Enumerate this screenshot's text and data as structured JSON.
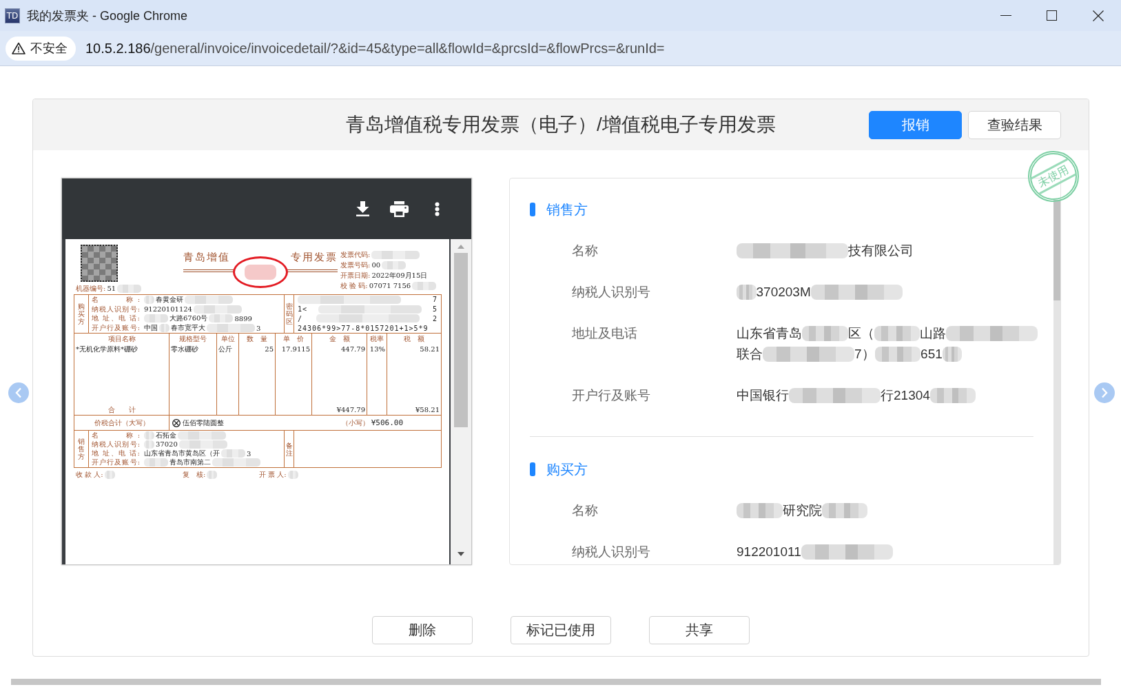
{
  "window": {
    "icon_label": "TD",
    "title": "我的发票夹 - Google Chrome"
  },
  "address_bar": {
    "security_label": "不安全",
    "url_host": "10.5.2.186",
    "url_path": "/general/invoice/invoicedetail/?&id=45&type=all&flowId=&prcsId=&flowPrcs=&runId="
  },
  "dialog": {
    "title": "青岛增值税专用发票（电子）/增值税电子专用发票",
    "actions": [
      {
        "label": "报销",
        "kind": "primary"
      },
      {
        "label": "查验结果",
        "kind": "default"
      }
    ],
    "stamp": "未使用"
  },
  "invoice": {
    "machine_number": {
      "label": "机器编号:",
      "value": [
        {
          "kind": "text",
          "text": "51"
        },
        {
          "kind": "mask_medium"
        }
      ]
    },
    "title": [
      "青岛增值",
      "专用发票"
    ],
    "header_fields": [
      {
        "label": "发票代码:",
        "value": [
          {
            "kind": "mask_long"
          }
        ]
      },
      {
        "label": "发票号码:",
        "value": [
          {
            "kind": "text",
            "text": "00"
          },
          {
            "kind": "mask_medium"
          }
        ]
      },
      {
        "label": "开票日期:",
        "value": [
          {
            "kind": "text",
            "text": "2022年09月15日"
          }
        ]
      },
      {
        "label": "校 验 码:",
        "value": [
          {
            "kind": "text",
            "text": "07071 7156"
          },
          {
            "kind": "mask_medium"
          }
        ]
      }
    ],
    "buyer": {
      "side_label": "购买方",
      "rows": [
        {
          "label": "名　　称:",
          "value": [
            {
              "kind": "mask_short"
            },
            {
              "kind": "text",
              "text": "春黄金研"
            },
            {
              "kind": "mask_long"
            }
          ]
        },
        {
          "label": "纳税人识别号:",
          "value": [
            {
              "kind": "text",
              "text": "91220101124"
            },
            {
              "kind": "mask_long"
            }
          ]
        },
        {
          "label": "地 址、电 话:",
          "value": [
            {
              "kind": "mask_medium"
            },
            {
              "kind": "text",
              "text": "大路6760号"
            },
            {
              "kind": "mask_medium"
            },
            {
              "kind": "text",
              "text": "8899"
            }
          ]
        },
        {
          "label": "开户行及账号:",
          "value": [
            {
              "kind": "text",
              "text": "中国"
            },
            {
              "kind": "mask_short"
            },
            {
              "kind": "text",
              "text": "春市宽平大"
            },
            {
              "kind": "mask_long"
            },
            {
              "kind": "text",
              "text": "3"
            }
          ]
        }
      ]
    },
    "cipher": {
      "side_label": "密码区",
      "lines": [
        [
          {
            "kind": "mask_full"
          },
          {
            "kind": "text",
            "text": "7"
          }
        ],
        [
          {
            "kind": "text",
            "text": "1<"
          },
          {
            "kind": "mask_full"
          },
          {
            "kind": "text",
            "text": "5"
          }
        ],
        [
          {
            "kind": "text",
            "text": "/"
          },
          {
            "kind": "mask_full"
          },
          {
            "kind": "text",
            "text": "2"
          }
        ],
        [
          {
            "kind": "text",
            "text": "24306*99>77-8*0157201+1>5*9"
          }
        ]
      ]
    },
    "items": {
      "columns": [
        "项目名称",
        "规格型号",
        "单位",
        "数　量",
        "单　价",
        "金　额",
        "税率",
        "税　额"
      ],
      "rows": [
        [
          "*无机化学原料*硼砂",
          "零水硼砂",
          "公斤",
          "25",
          "17.9115",
          "447.79",
          "13%",
          "58.21"
        ]
      ],
      "total_label": "合　　计",
      "total_amount": "¥447.79",
      "total_tax": "¥58.21"
    },
    "grand_total": {
      "label": "价税合计（大写）",
      "words": "伍佰零陆圆整",
      "figure_label": "（小写）",
      "figure": "¥506.00"
    },
    "seller": {
      "side_label": "销售方",
      "rows": [
        {
          "label": "名　　称:",
          "value": [
            {
              "kind": "mask_short"
            },
            {
              "kind": "text",
              "text": "石拓金"
            },
            {
              "kind": "mask_long"
            }
          ]
        },
        {
          "label": "纳税人识别号:",
          "value": [
            {
              "kind": "mask_short"
            },
            {
              "kind": "text",
              "text": "37020"
            },
            {
              "kind": "mask_long"
            }
          ]
        },
        {
          "label": "地 址、电 话:",
          "value": [
            {
              "kind": "text",
              "text": "山东省青岛市黄岛区（开"
            },
            {
              "kind": "mask_medium"
            },
            {
              "kind": "text",
              "text": "3"
            }
          ]
        },
        {
          "label": "开户行及账号:",
          "value": [
            {
              "kind": "mask_medium"
            },
            {
              "kind": "text",
              "text": "青岛市南第二"
            },
            {
              "kind": "mask_long"
            }
          ]
        }
      ],
      "remarks_label": "备注"
    },
    "signatures": [
      {
        "label": "收 款 人:",
        "value": [
          {
            "kind": "mask_short"
          }
        ]
      },
      {
        "label": "复　核:",
        "value": [
          {
            "kind": "mask_short"
          }
        ]
      },
      {
        "label": "开 票 人:",
        "value": [
          {
            "kind": "mask_short"
          }
        ]
      }
    ]
  },
  "details": {
    "sections": [
      {
        "title": "销售方",
        "fields": [
          {
            "label": "名称",
            "lines": [
              [
                {
                  "kind": "mask_xlong"
                },
                {
                  "kind": "text",
                  "text": "技有限公司"
                }
              ]
            ]
          },
          {
            "label": "纳税人识别号",
            "lines": [
              [
                {
                  "kind": "mask_short"
                },
                {
                  "kind": "text",
                  "text": "370203M"
                },
                {
                  "kind": "mask_long"
                }
              ]
            ]
          },
          {
            "label": "地址及电话",
            "lines": [
              [
                {
                  "kind": "text",
                  "text": "山东省青岛"
                },
                {
                  "kind": "mask_medium"
                },
                {
                  "kind": "text",
                  "text": "区（"
                },
                {
                  "kind": "mask_medium"
                },
                {
                  "kind": "text",
                  "text": "山路"
                },
                {
                  "kind": "mask_long"
                }
              ],
              [
                {
                  "kind": "text",
                  "text": "联合"
                },
                {
                  "kind": "mask_long"
                },
                {
                  "kind": "text",
                  "text": "7）"
                },
                {
                  "kind": "mask_medium"
                },
                {
                  "kind": "text",
                  "text": "651"
                },
                {
                  "kind": "mask_short"
                }
              ]
            ]
          },
          {
            "label": "开户行及账号",
            "lines": [
              [
                {
                  "kind": "text",
                  "text": "中国银行"
                },
                {
                  "kind": "mask_long"
                },
                {
                  "kind": "text",
                  "text": "行21304"
                },
                {
                  "kind": "mask_medium"
                }
              ]
            ]
          }
        ]
      },
      {
        "title": "购买方",
        "fields": [
          {
            "label": "名称",
            "lines": [
              [
                {
                  "kind": "mask_medium"
                },
                {
                  "kind": "text",
                  "text": "研究院"
                },
                {
                  "kind": "mask_medium"
                }
              ]
            ]
          },
          {
            "label": "纳税人识别号",
            "lines": [
              [
                {
                  "kind": "text",
                  "text": "912201011"
                },
                {
                  "kind": "mask_long"
                }
              ]
            ]
          }
        ]
      }
    ]
  },
  "footer_buttons": [
    "删除",
    "标记已使用",
    "共享"
  ]
}
